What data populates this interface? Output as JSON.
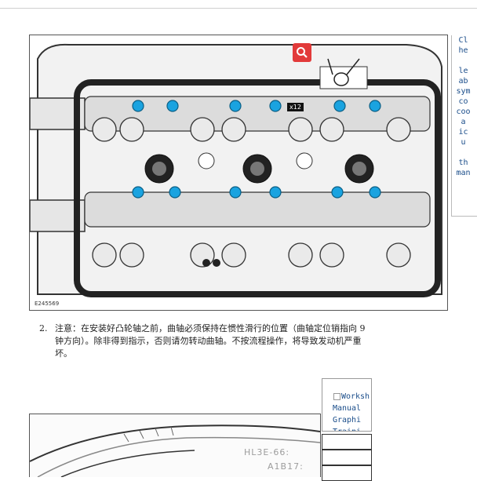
{
  "main_figure": {
    "figure_code": "E245569",
    "quantity_callout": "x12",
    "icons": [
      "zoom-icon",
      "oil-can-icon"
    ]
  },
  "side_panel": {
    "alt_text": "Cl\nhe\n\nle\nab\nsym\nco\ncoo\na\nic\nu\n\nth\nman"
  },
  "step": {
    "number": "2.",
    "line1": "注意：在安装好凸轮轴之前，曲轴必须保持在惯性滑行的位置（曲轴定位销指向 9",
    "line2": "钟方向）。除非得到指示，否则请勿转动曲轴。不按流程操作，将导致发动机严重",
    "line3": "坏。"
  },
  "thumbnail_link": {
    "text": "Worksh\nManual\nGraphi\nTraini"
  },
  "second_figure": {
    "part_number_line1": "HL3E-66:",
    "part_number_line2": "A1B17:"
  },
  "colors": {
    "zoom_button": "#e23a3a",
    "bolt_blue": "#1aa3e0",
    "link_text": "#1a4d8a"
  }
}
